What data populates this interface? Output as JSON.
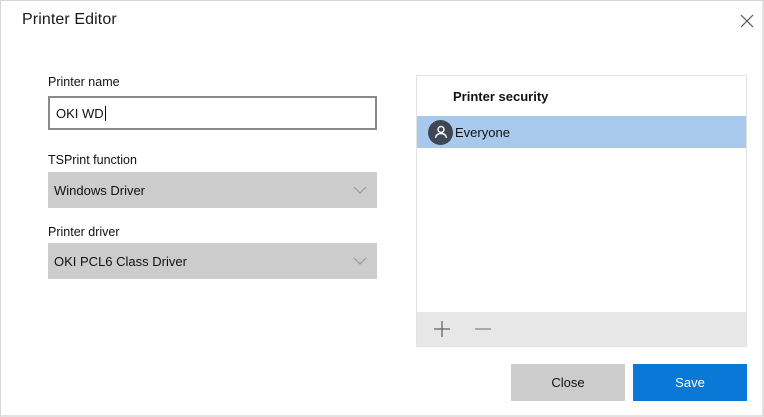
{
  "window": {
    "title": "Printer Editor",
    "close_icon": "close-icon"
  },
  "form": {
    "printer_name": {
      "label": "Printer name",
      "value": "OKI WD"
    },
    "tsprint_function": {
      "label": "TSPrint function",
      "selected": "Windows Driver",
      "icon": "chevron-down-icon"
    },
    "printer_driver": {
      "label": "Printer driver",
      "selected": "OKI PCL6 Class Driver",
      "icon": "chevron-down-icon"
    }
  },
  "security": {
    "title": "Printer security",
    "items": [
      {
        "label": "Everyone",
        "icon": "user-icon",
        "selected": true
      }
    ],
    "toolbar": {
      "add_icon": "plus-icon",
      "remove_icon": "minus-icon"
    }
  },
  "footer": {
    "close_label": "Close",
    "save_label": "Save"
  },
  "colors": {
    "accent": "#0a78d6",
    "selection": "#a8c9ec",
    "select_bg": "#cccccc",
    "toolbar_bg": "#e7e7e7"
  }
}
